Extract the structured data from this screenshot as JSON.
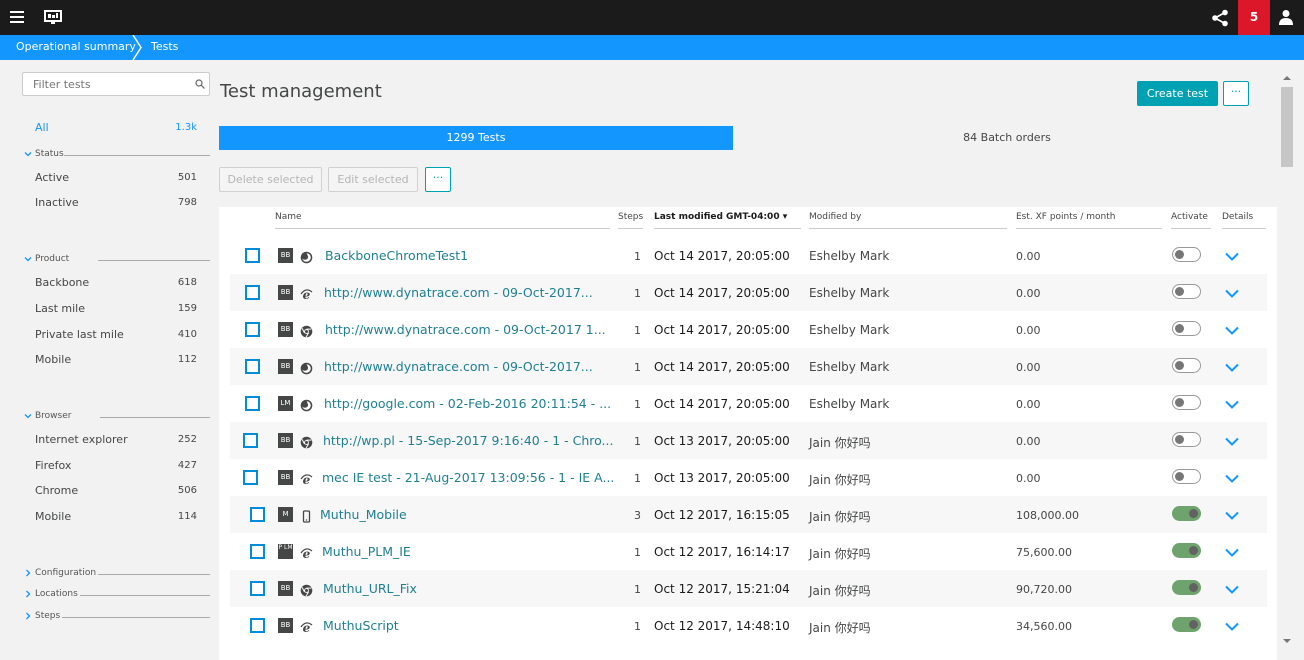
{
  "breadcrumb": {
    "items": [
      "Operational summary",
      "Tests"
    ]
  },
  "notifications": {
    "count": "5"
  },
  "sidebar": {
    "filter_placeholder": "Filter tests",
    "all": {
      "label": "All",
      "count": "1.3k"
    },
    "sections": [
      {
        "title": "Status",
        "items": [
          {
            "label": "Active",
            "count": "501"
          },
          {
            "label": "Inactive",
            "count": "798"
          }
        ]
      },
      {
        "title": "Product",
        "items": [
          {
            "label": "Backbone",
            "count": "618"
          },
          {
            "label": "Last mile",
            "count": "159"
          },
          {
            "label": "Private last mile",
            "count": "410"
          },
          {
            "label": "Mobile",
            "count": "112"
          }
        ]
      },
      {
        "title": "Browser",
        "items": [
          {
            "label": "Internet explorer",
            "count": "252"
          },
          {
            "label": "Firefox",
            "count": "427"
          },
          {
            "label": "Chrome",
            "count": "506"
          },
          {
            "label": "Mobile",
            "count": "114"
          }
        ]
      }
    ],
    "collapsed": [
      "Configuration",
      "Locations",
      "Steps"
    ]
  },
  "main": {
    "title": "Test management",
    "create_label": "Create test",
    "more_label": "···",
    "tabs": {
      "active": "1299 Tests",
      "inactive": "84 Batch orders"
    },
    "delete_label": "Delete selected",
    "edit_label": "Edit selected"
  },
  "table": {
    "headers": {
      "name": "Name",
      "steps": "Steps",
      "modified": "Last modified GMT-04:00 ▾",
      "by": "Modified by",
      "xf": "Est. XF points / month",
      "activate": "Activate",
      "details": "Details"
    },
    "rows": [
      {
        "tag": "BB",
        "browser": "firefox-icon",
        "name": "BackboneChromeTest1",
        "steps": "1",
        "modified": "Oct 14 2017, 20:05:00",
        "by": "Eshelby Mark",
        "xf": "0.00",
        "active": false
      },
      {
        "tag": "BB",
        "browser": "ie-icon",
        "name": "http://www.dynatrace.com - 09-Oct-2017...",
        "steps": "1",
        "modified": "Oct 14 2017, 20:05:00",
        "by": "Eshelby Mark",
        "xf": "0.00",
        "active": false
      },
      {
        "tag": "BB",
        "browser": "chrome-icon",
        "name": "http://www.dynatrace.com - 09-Oct-2017 1...",
        "steps": "1",
        "modified": "Oct 14 2017, 20:05:00",
        "by": "Eshelby Mark",
        "xf": "0.00",
        "active": false
      },
      {
        "tag": "BB",
        "browser": "firefox-icon",
        "name": "http://www.dynatrace.com - 09-Oct-2017...",
        "steps": "1",
        "modified": "Oct 14 2017, 20:05:00",
        "by": "Eshelby Mark",
        "xf": "0.00",
        "active": false
      },
      {
        "tag": "LM",
        "browser": "firefox-icon",
        "name": "http://google.com - 02-Feb-2016 20:11:54 - ...",
        "steps": "1",
        "modified": "Oct 14 2017, 20:05:00",
        "by": "Eshelby Mark",
        "xf": "0.00",
        "active": false
      },
      {
        "tag": "BB",
        "browser": "chrome-icon",
        "name": "http://wp.pl - 15-Sep-2017 9:16:40 - 1 - Chro...",
        "steps": "1",
        "modified": "Oct 13 2017, 20:05:00",
        "by": "Jain 你好吗",
        "xf": "0.00",
        "active": false
      },
      {
        "tag": "BB",
        "browser": "ie-icon",
        "name": "mec IE test - 21-Aug-2017 13:09:56 - 1 - IE A...",
        "steps": "1",
        "modified": "Oct 13 2017, 20:05:00",
        "by": "Jain 你好吗",
        "xf": "0.00",
        "active": false
      },
      {
        "tag": "M",
        "browser": "mobile-icon",
        "name": "Muthu_Mobile",
        "steps": "3",
        "modified": "Oct 12 2017, 16:15:05",
        "by": "Jain 你好吗",
        "xf": "108,000.00",
        "active": true
      },
      {
        "tag": "P LM",
        "browser": "ie-icon",
        "name": "Muthu_PLM_IE",
        "steps": "1",
        "modified": "Oct 12 2017, 16:14:17",
        "by": "Jain 你好吗",
        "xf": "75,600.00",
        "active": true
      },
      {
        "tag": "BB",
        "browser": "chrome-icon",
        "name": "Muthu_URL_Fix",
        "steps": "1",
        "modified": "Oct 12 2017, 15:21:04",
        "by": "Jain 你好吗",
        "xf": "90,720.00",
        "active": true
      },
      {
        "tag": "BB",
        "browser": "ie-icon",
        "name": "MuthuScript",
        "steps": "1",
        "modified": "Oct 12 2017, 14:48:10",
        "by": "Jain 你好吗",
        "xf": "34,560.00",
        "active": true
      }
    ]
  }
}
